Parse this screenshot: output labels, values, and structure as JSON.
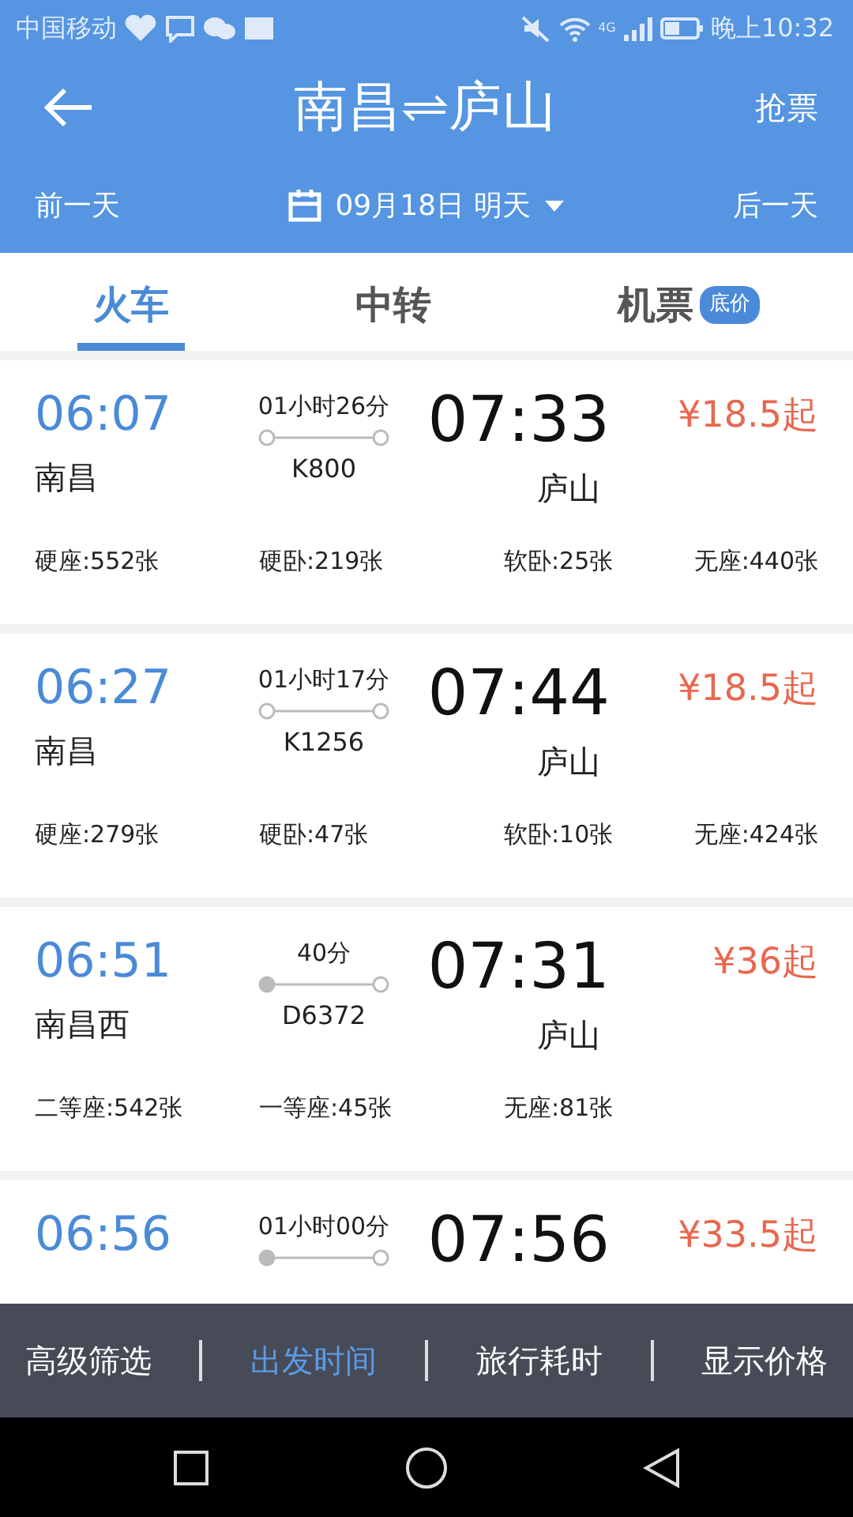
{
  "status_bar": {
    "carrier": "中国移动",
    "network": "4G",
    "time": "晚上10:32"
  },
  "header": {
    "title_from": "南昌",
    "title_to": "庐山",
    "action": "抢票"
  },
  "date_bar": {
    "prev": "前一天",
    "date": "09月18日 明天",
    "next": "后一天"
  },
  "tabs": [
    {
      "label": "火车",
      "selected": true
    },
    {
      "label": "中转",
      "selected": false
    },
    {
      "label": "机票",
      "selected": false,
      "badge": "底价"
    }
  ],
  "trains": [
    {
      "depart": "06:07",
      "from": "南昌",
      "duration": "01小时26分",
      "origin_stop": false,
      "train": "K800",
      "arrive": "07:33",
      "to": "庐山",
      "price": "¥18.5起",
      "seats": [
        "硬座:552张",
        "硬卧:219张",
        "软卧:25张",
        "无座:440张"
      ]
    },
    {
      "depart": "06:27",
      "from": "南昌",
      "duration": "01小时17分",
      "origin_stop": false,
      "train": "K1256",
      "arrive": "07:44",
      "to": "庐山",
      "price": "¥18.5起",
      "seats": [
        "硬座:279张",
        "硬卧:47张",
        "软卧:10张",
        "无座:424张"
      ]
    },
    {
      "depart": "06:51",
      "from": "南昌西",
      "duration": "40分",
      "origin_stop": true,
      "train": "D6372",
      "arrive": "07:31",
      "to": "庐山",
      "price": "¥36起",
      "seats": [
        "二等座:542张",
        "一等座:45张",
        "无座:81张"
      ]
    },
    {
      "depart": "06:56",
      "duration": "01小时00分",
      "origin_stop": true,
      "arrive": "07:56",
      "price": "¥33.5起"
    }
  ],
  "bottom_bar": [
    {
      "label": "高级筛选",
      "selected": false
    },
    {
      "label": "出发时间",
      "selected": true
    },
    {
      "label": "旅行耗时",
      "selected": false
    },
    {
      "label": "显示价格",
      "selected": false
    }
  ]
}
